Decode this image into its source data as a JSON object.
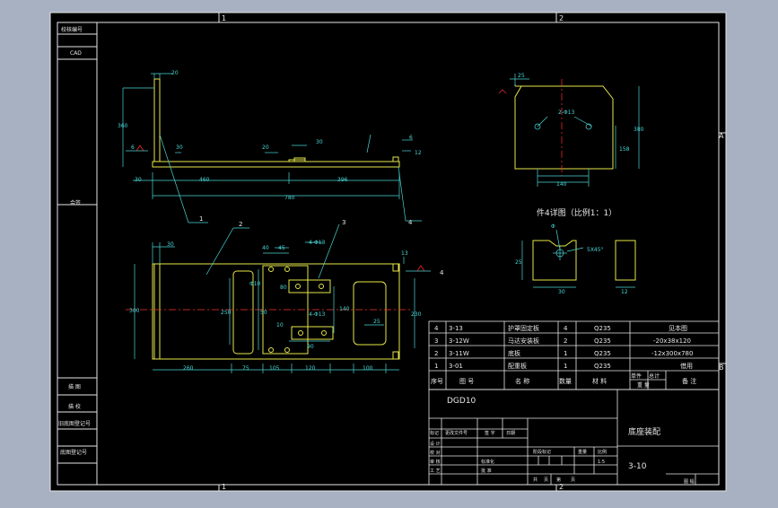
{
  "window": {
    "background": "#a7b1c2",
    "paper": "#000000"
  },
  "colors": {
    "frame": "#e6e6e6",
    "outline": "#e6e64a",
    "dimension": "#4ad6d6",
    "center": "#ff3030",
    "leader": "#4ad6d6"
  },
  "border": {
    "zone_top_left": "1",
    "zone_top_right": "2",
    "zone_bot_left": "1",
    "zone_bot_right": "2",
    "zone_right_a": "A",
    "zone_right_b": "B"
  },
  "left_strip": {
    "top_cell_1": "校核编号",
    "top_cell_2": "CAD",
    "mid_cell": "会签",
    "bot_cell_1": "描 图",
    "bot_cell_2": "描 校",
    "bot_cell_3": "旧底图登记号",
    "bot_cell_4": "底图登记号"
  },
  "front_view": {
    "dims": {
      "d20": "20",
      "d360": "360",
      "d6": "6",
      "d30a": "30",
      "d20b": "20",
      "d30b": "30",
      "d6b": "6",
      "d12": "12",
      "d30c": "30",
      "d460": "460",
      "d396": "396",
      "d780": "780"
    },
    "weld": "6",
    "callouts": {
      "c1": "1",
      "c4": "4"
    }
  },
  "top_view": {
    "dims": {
      "d30": "30",
      "d40": "40",
      "d45": "45",
      "hole_a": "4-Φ13",
      "d300": "300",
      "d250": "250",
      "d260": "260",
      "d75": "75",
      "d105": "105",
      "d120": "120",
      "d100": "100",
      "d80": "80",
      "d140": "140",
      "d90": "90",
      "hole_b": "4-Φ13",
      "d25": "25",
      "d230": "230",
      "d13": "13",
      "d10": "10",
      "d50": "50",
      "phi10": "Φ10"
    },
    "callouts": {
      "c2": "2",
      "c3": "3",
      "c4": "4"
    }
  },
  "plate_view": {
    "dims": {
      "d25": "25",
      "hole": "2-Φ13",
      "d380": "380",
      "d158": "158",
      "d140": "140"
    }
  },
  "detail": {
    "title": "件4详图（比例1：1）",
    "dims": {
      "d25": "25",
      "chamfer": "5X45°",
      "d30": "30",
      "d12": "12",
      "phi": "Φ"
    }
  },
  "bom": {
    "rows": [
      {
        "no": "4",
        "code": "3-13",
        "name": "护罩固定板",
        "qty": "4",
        "mat": "Q235",
        "note": "见本图"
      },
      {
        "no": "3",
        "code": "3-12W",
        "name": "马达安装板",
        "qty": "2",
        "mat": "Q235",
        "note": "-20x38x120"
      },
      {
        "no": "2",
        "code": "3-11W",
        "name": "底板",
        "qty": "1",
        "mat": "Q235",
        "note": "-12x300x780"
      },
      {
        "no": "1",
        "code": "3-01",
        "name": "配重板",
        "qty": "1",
        "mat": "Q235",
        "note": "借用"
      }
    ],
    "header": {
      "no": "序号",
      "code": "图 号",
      "name": "名 称",
      "qty": "数量",
      "mat": "材 料",
      "single": "单件",
      "total": "总计",
      "weight": "重 量",
      "note": "备 注"
    }
  },
  "title_block": {
    "product": "DGD10",
    "drawing_name": "底座装配",
    "drawing_no": "3-10",
    "scale": "1:5",
    "rev_mark": "标记",
    "rev_file": "更改文件号",
    "rev_sign": "签 字",
    "rev_date": "日期",
    "design": "设 计",
    "check": "校 对",
    "review": "审 核",
    "approve": "工 艺",
    "standard": "标准化",
    "ratify": "批 准",
    "stage_mark": "阶段标记",
    "weight": "重量",
    "ratio": "比例",
    "total_pages": "共",
    "page_unit": "页",
    "page_no": "第",
    "page_unit2": "页"
  },
  "corner_label": "图 幅"
}
